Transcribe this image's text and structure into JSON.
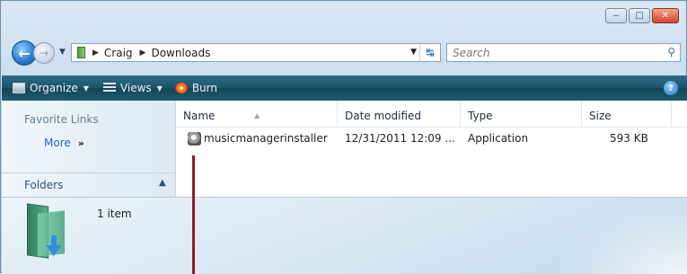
{
  "window": {
    "buttons": {
      "minimize": "‒",
      "maximize": "□",
      "close": "✕"
    }
  },
  "nav": {
    "breadcrumbs": [
      "Craig",
      "Downloads"
    ],
    "search_placeholder": "Search"
  },
  "toolbar": {
    "organize": "Organize",
    "views": "Views",
    "burn": "Burn",
    "help": "?"
  },
  "left_pane": {
    "favorite_links": "Favorite Links",
    "more": "More",
    "more_arrows": "»",
    "folders": "Folders"
  },
  "file_list": {
    "columns": [
      "Name",
      "Date modified",
      "Type",
      "Size"
    ],
    "rows": [
      {
        "name": "musicmanagerinstaller",
        "date_modified": "12/31/2011 12:09 ...",
        "type": "Application",
        "size": "593 KB",
        "icon": "application-icon"
      }
    ]
  },
  "details": {
    "item_count": "1 item"
  },
  "colors": {
    "toolbar": "#1d5369",
    "callout_line": "#8b1e2a",
    "link": "#2a63b4"
  }
}
